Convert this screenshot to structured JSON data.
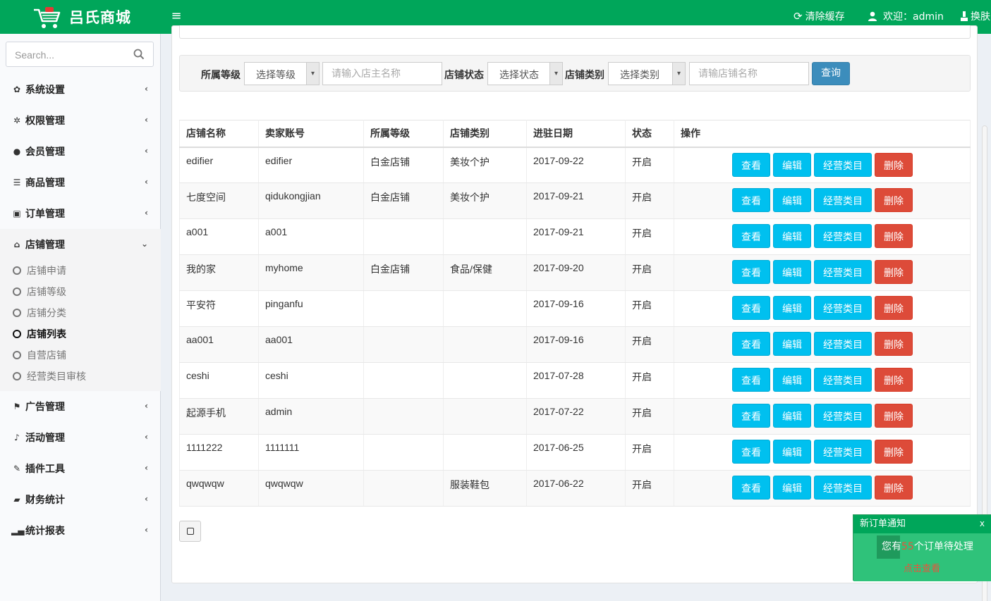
{
  "header": {
    "brand": "吕氏商城",
    "clear_cache": "清除缓存",
    "welcome": "欢迎：admin",
    "skin": "换肤",
    "color": "#00a65a"
  },
  "sidebar": {
    "search_placeholder": "Search...",
    "items": [
      {
        "label": "系统设置",
        "icon": "gear-icon"
      },
      {
        "label": "权限管理",
        "icon": "gears-icon"
      },
      {
        "label": "会员管理",
        "icon": "user-icon"
      },
      {
        "label": "商品管理",
        "icon": "list-icon"
      },
      {
        "label": "订单管理",
        "icon": "money-icon"
      },
      {
        "label": "店铺管理",
        "icon": "home-icon"
      },
      {
        "label": "广告管理",
        "icon": "flag-icon"
      },
      {
        "label": "活动管理",
        "icon": "bell-icon"
      },
      {
        "label": "插件工具",
        "icon": "wrench-icon"
      },
      {
        "label": "财务统计",
        "icon": "book-icon"
      },
      {
        "label": "统计报表",
        "icon": "signal-icon"
      }
    ],
    "store_sub": [
      {
        "label": "店铺申请"
      },
      {
        "label": "店铺等级"
      },
      {
        "label": "店铺分类"
      },
      {
        "label": "店铺列表"
      },
      {
        "label": "自营店铺"
      },
      {
        "label": "经营类目审核"
      }
    ]
  },
  "filter": {
    "level_label": "所属等级",
    "level_select": "选择等级",
    "owner_placeholder": "请输入店主名称",
    "status_label": "店铺状态",
    "status_select": "选择状态",
    "category_label": "店铺类别",
    "category_select": "选择类别",
    "store_placeholder": "请输店铺名称",
    "query_button": "查询"
  },
  "table": {
    "headers": [
      "店铺名称",
      "卖家账号",
      "所属等级",
      "店铺类别",
      "进驻日期",
      "状态",
      "操作"
    ],
    "actions": {
      "view": "查看",
      "edit": "编辑",
      "category": "经营类目",
      "delete": "删除"
    },
    "rows": [
      [
        "edifier",
        "edifier",
        "白金店铺",
        "美妆个护",
        "2017-09-22",
        "开启"
      ],
      [
        "七度空间",
        "qidukongjian",
        "白金店铺",
        "美妆个护",
        "2017-09-21",
        "开启"
      ],
      [
        "a001",
        "a001",
        "",
        "",
        "2017-09-21",
        "开启"
      ],
      [
        "我的家",
        "myhome",
        "白金店铺",
        "食品/保健",
        "2017-09-20",
        "开启"
      ],
      [
        "平安符",
        "pinganfu",
        "",
        "",
        "2017-09-16",
        "开启"
      ],
      [
        "aa001",
        "aa001",
        "",
        "",
        "2017-09-16",
        "开启"
      ],
      [
        "ceshi",
        "ceshi",
        "",
        "",
        "2017-07-28",
        "开启"
      ],
      [
        "起源手机",
        "admin",
        "",
        "",
        "2017-07-22",
        "开启"
      ],
      [
        "1111222",
        "1111111",
        "",
        "",
        "2017-06-25",
        "开启"
      ],
      [
        "qwqwqw",
        "qwqwqw",
        "",
        "服装鞋包",
        "2017-06-22",
        "开启"
      ]
    ]
  },
  "notification": {
    "title": "新订单通知",
    "close": "x",
    "prefix": "您有",
    "count": "55",
    "suffix": "个订单待处理",
    "link": "点击查看"
  }
}
